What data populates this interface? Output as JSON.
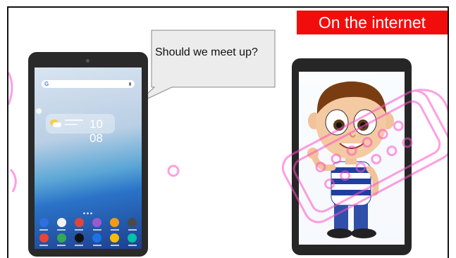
{
  "banner": {
    "label": "On the internet"
  },
  "bubble": {
    "text": "Should we meet up?"
  },
  "tablet_left": {
    "clock": "10 08",
    "search_logo": "G"
  },
  "icons": [
    "camera-icon",
    "mic-icon",
    "weather-icon",
    "keyboard-watermark-icon"
  ],
  "colors": {
    "banner_bg": "#f20d0d",
    "banner_text": "#ffffff",
    "watermark": "#ff4fc8",
    "bubble_bg": "#ececec"
  }
}
